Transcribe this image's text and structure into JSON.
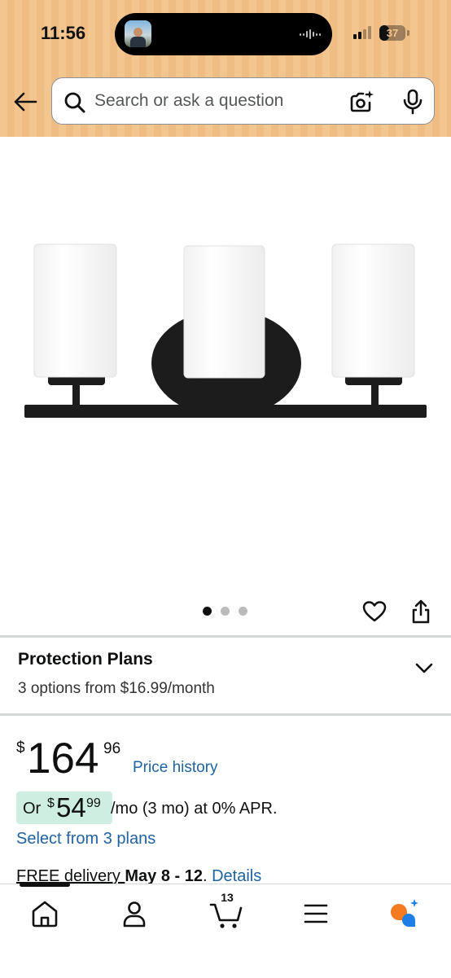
{
  "status_bar": {
    "time": "11:56",
    "battery": "37",
    "battery_level": 0.37
  },
  "search": {
    "placeholder": "Search or ask a question"
  },
  "product": {
    "image_count": 3,
    "active_image_index": 0
  },
  "protection_plans": {
    "title": "Protection Plans",
    "subtitle": "3 options from $16.99/month"
  },
  "price": {
    "currency_symbol": "$",
    "whole": "164",
    "fraction": "96",
    "history_link": "Price history"
  },
  "monthly": {
    "or_label": "Or",
    "currency_symbol": "$",
    "whole": "54",
    "fraction": "99",
    "terms": "/mo (3 mo) at 0% APR.",
    "select_plans": "Select from 3 plans"
  },
  "delivery": {
    "free_label": "FREE",
    "delivery_word": " delivery ",
    "dates": "May 8 - 12",
    "period": ". ",
    "details_link": "Details"
  },
  "bottom_nav": {
    "cart_count": "13",
    "items": [
      "home-icon",
      "account-icon",
      "cart-icon",
      "menu-icon",
      "rufus-icon"
    ]
  },
  "colors": {
    "header_bg": "#f3c58f",
    "link": "#2162a1",
    "monthly_badge": "#cdeee1"
  }
}
